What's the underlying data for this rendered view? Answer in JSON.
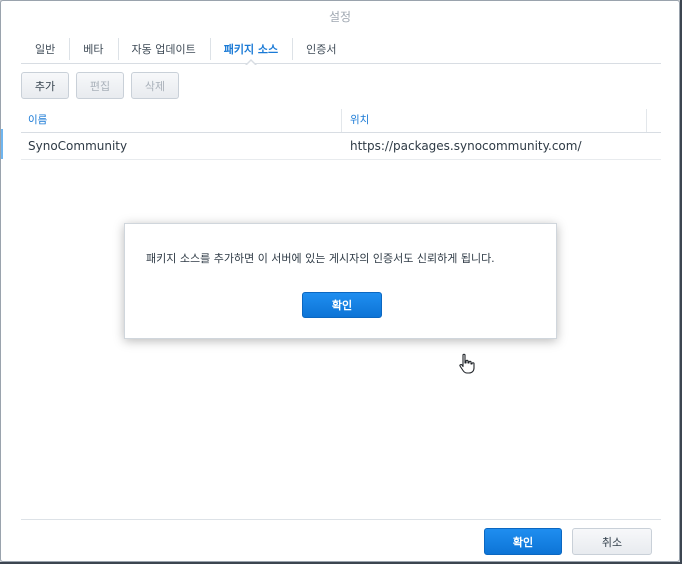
{
  "window": {
    "title": "설정"
  },
  "tabs": [
    {
      "label": "일반",
      "active": false
    },
    {
      "label": "베타",
      "active": false
    },
    {
      "label": "자동 업데이트",
      "active": false
    },
    {
      "label": "패키지 소스",
      "active": true
    },
    {
      "label": "인증서",
      "active": false
    }
  ],
  "toolbar": {
    "add_label": "추가",
    "edit_label": "편집",
    "delete_label": "삭제"
  },
  "grid": {
    "columns": [
      "이름",
      "위치"
    ],
    "rows": [
      {
        "name": "SynoCommunity",
        "location": "https://packages.synocommunity.com/"
      }
    ]
  },
  "dialog": {
    "message": "패키지 소스를 추가하면 이 서버에 있는 게시자의 인증서도 신뢰하게 됩니다.",
    "ok_label": "확인"
  },
  "footer": {
    "ok_label": "확인",
    "cancel_label": "취소"
  },
  "colors": {
    "accent": "#1a7ad6",
    "primary_button": "#0d74d6"
  }
}
